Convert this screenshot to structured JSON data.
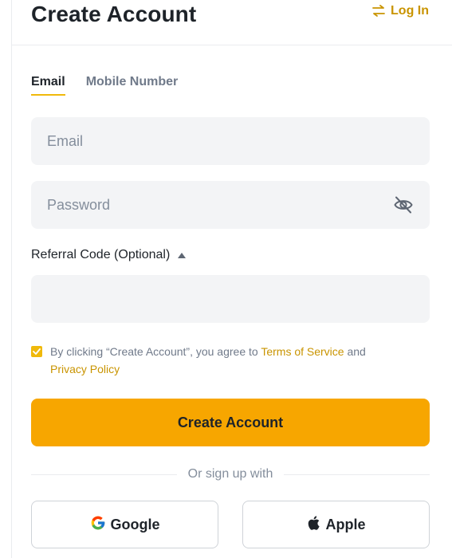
{
  "header": {
    "title": "Create Account",
    "login_label": "Log In"
  },
  "tabs": [
    {
      "label": "Email",
      "active": true
    },
    {
      "label": "Mobile Number",
      "active": false
    }
  ],
  "form": {
    "email": {
      "placeholder": "Email",
      "value": ""
    },
    "password": {
      "placeholder": "Password",
      "value": ""
    },
    "referral": {
      "label": "Referral Code (Optional)",
      "value": ""
    }
  },
  "agreement": {
    "checked": true,
    "prefix": "By clicking “Create Account”, you agree to ",
    "terms_label": "Terms of Service",
    "middle": " and",
    "privacy_label": "Privacy Policy"
  },
  "create_button_label": "Create Account",
  "divider_text": "Or sign up with",
  "social": {
    "google_label": "Google",
    "apple_label": "Apple"
  },
  "colors": {
    "accent": "#f7a600",
    "link": "#c99400",
    "field_bg": "#f3f4f6"
  }
}
